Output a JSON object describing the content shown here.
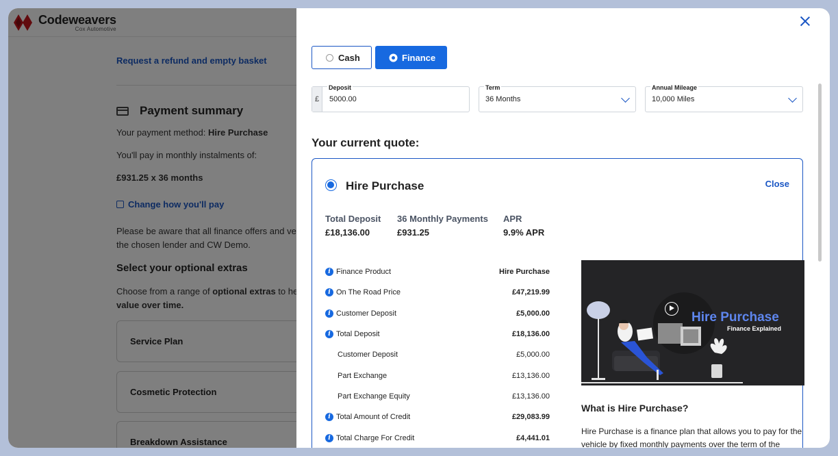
{
  "brand": {
    "name": "Codeweavers",
    "sub": "Cox Automotive"
  },
  "background": {
    "refund_link": "Request a refund and empty basket",
    "payment_summary_title": "Payment summary",
    "payment_method_prefix": "Your payment method: ",
    "payment_method": "Hire Purchase",
    "instalments_text": "You'll pay in monthly instalments of:",
    "instalments_value": "£931.25 x 36 months",
    "change_link": "Change how you'll pay",
    "notice_line1": "Please be aware that all finance offers and ve",
    "notice_line2": "the chosen lender and CW Demo.",
    "extras_title": "Select your optional extras",
    "extras_desc_a": "Choose from a range of ",
    "extras_desc_b": "optional extras",
    "extras_desc_c": " to he",
    "extras_desc_d": "value over time.",
    "extras": [
      "Service Plan",
      "Cosmetic Protection",
      "Breakdown Assistance"
    ]
  },
  "panel": {
    "payment_toggle": {
      "cash_label": "Cash",
      "finance_label": "Finance",
      "selected": "Finance"
    },
    "deposit": {
      "label": "Deposit",
      "prefix": "£",
      "value": "5000.00"
    },
    "term": {
      "label": "Term",
      "value": "36 Months"
    },
    "mileage": {
      "label": "Annual Mileage",
      "value": "10,000 Miles"
    },
    "quote_title": "Your current quote:",
    "quote": {
      "title": "Hire Purchase",
      "close_label": "Close",
      "summary": [
        {
          "label": "Total Deposit",
          "value": "£18,136.00"
        },
        {
          "label": "36 Monthly Payments",
          "value": "£931.25"
        },
        {
          "label": "APR",
          "value": "9.9% APR"
        }
      ],
      "rows": [
        {
          "label": "Finance Product",
          "value": "Hire Purchase",
          "info": true
        },
        {
          "label": "On The Road Price",
          "value": "£47,219.99",
          "info": true
        },
        {
          "label": "Customer Deposit",
          "value": "£5,000.00",
          "info": true
        },
        {
          "label": "Total Deposit",
          "value": "£18,136.00",
          "info": true
        },
        {
          "label": "Customer Deposit",
          "value": "£5,000.00",
          "info": false
        },
        {
          "label": "Part Exchange",
          "value": "£13,136.00",
          "info": false
        },
        {
          "label": "Part Exchange Equity",
          "value": "£13,136.00",
          "info": false
        },
        {
          "label": "Total Amount of Credit",
          "value": "£29,083.99",
          "info": true
        },
        {
          "label": "Total Charge For Credit",
          "value": "£4,441.01",
          "info": true
        }
      ],
      "video": {
        "title": "Hire Purchase",
        "subtitle": "Finance Explained"
      },
      "what_title": "What is Hire Purchase?",
      "what_text": "Hire Purchase is a finance plan that allows you to pay for the vehicle by fixed monthly payments over the term of the"
    }
  },
  "colors": {
    "accent": "#1769e0",
    "link": "#1a56c4",
    "overlay": "rgba(0,0,0,0.5)",
    "video_bg": "#242426"
  }
}
